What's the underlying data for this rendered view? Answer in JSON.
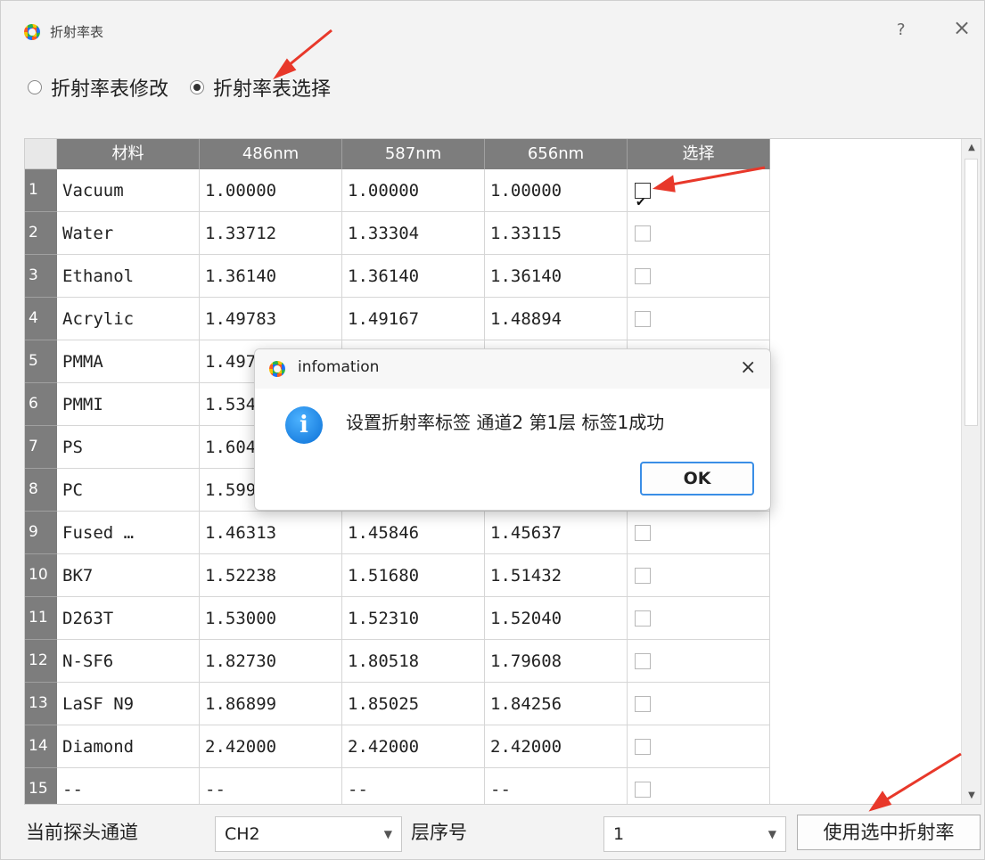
{
  "window": {
    "title": "折射率表",
    "help": "?",
    "close": "×"
  },
  "mode_radios": [
    {
      "label": "折射率表修改",
      "checked": false
    },
    {
      "label": "折射率表选择",
      "checked": true
    }
  ],
  "table": {
    "headers": [
      "材料",
      "486nm",
      "587nm",
      "656nm",
      "选择"
    ],
    "rows": [
      {
        "n": "1",
        "material": "Vacuum",
        "v486": "1.00000",
        "v587": "1.00000",
        "v656": "1.00000",
        "selected": true
      },
      {
        "n": "2",
        "material": "Water",
        "v486": "1.33712",
        "v587": "1.33304",
        "v656": "1.33115",
        "selected": false
      },
      {
        "n": "3",
        "material": "Ethanol",
        "v486": "1.36140",
        "v587": "1.36140",
        "v656": "1.36140",
        "selected": false
      },
      {
        "n": "4",
        "material": "Acrylic",
        "v486": "1.49783",
        "v587": "1.49167",
        "v656": "1.48894",
        "selected": false
      },
      {
        "n": "5",
        "material": "PMMA",
        "v486": "1.497",
        "v587": "",
        "v656": "",
        "selected": false
      },
      {
        "n": "6",
        "material": "PMMI",
        "v486": "1.534",
        "v587": "",
        "v656": "",
        "selected": false
      },
      {
        "n": "7",
        "material": "PS",
        "v486": "1.604",
        "v587": "",
        "v656": "",
        "selected": false
      },
      {
        "n": "8",
        "material": "PC",
        "v486": "1.599",
        "v587": "",
        "v656": "",
        "selected": false
      },
      {
        "n": "9",
        "material": "Fused …",
        "v486": "1.46313",
        "v587": "1.45846",
        "v656": "1.45637",
        "selected": false
      },
      {
        "n": "10",
        "material": "BK7",
        "v486": "1.52238",
        "v587": "1.51680",
        "v656": "1.51432",
        "selected": false
      },
      {
        "n": "11",
        "material": "D263T",
        "v486": "1.53000",
        "v587": "1.52310",
        "v656": "1.52040",
        "selected": false
      },
      {
        "n": "12",
        "material": "N-SF6",
        "v486": "1.82730",
        "v587": "1.80518",
        "v656": "1.79608",
        "selected": false
      },
      {
        "n": "13",
        "material": "LaSF N9",
        "v486": "1.86899",
        "v587": "1.85025",
        "v656": "1.84256",
        "selected": false
      },
      {
        "n": "14",
        "material": "Diamond",
        "v486": "2.42000",
        "v587": "2.42000",
        "v656": "2.42000",
        "selected": false
      },
      {
        "n": "15",
        "material": "--",
        "v486": "--",
        "v587": "--",
        "v656": "--",
        "selected": false
      }
    ]
  },
  "bottom_bar": {
    "channel_label": "当前探头通道",
    "channel_value": "CH2",
    "layer_label": "层序号",
    "layer_value": "1",
    "apply_button": "使用选中折射率"
  },
  "dialog": {
    "title": "infomation",
    "message": "设置折射率标签 通道2 第1层 标签1成功",
    "ok": "OK",
    "close": "×",
    "icon": "info-icon"
  },
  "colors": {
    "header_bg": "#7d7d7d",
    "annotation_arrow": "#e8382a",
    "ok_border": "#3a8ee6"
  }
}
